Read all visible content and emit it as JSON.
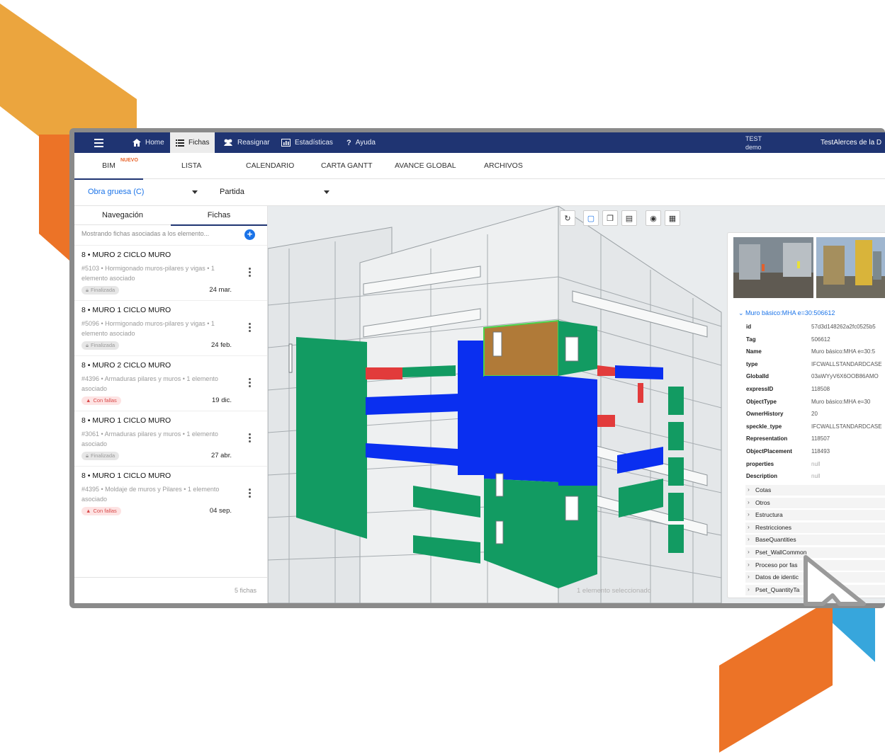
{
  "topbar": {
    "home": "Home",
    "fichas": "Fichas",
    "reasignar": "Reasignar",
    "estadisticas": "Estadísticas",
    "ayuda": "Ayuda",
    "user_line1": "TEST",
    "user_line2": "demo",
    "organization": "TestAlerces de la D"
  },
  "tabs": {
    "bim": "BIM",
    "bim_badge": "NUEVO",
    "lista": "LISTA",
    "calendario": "CALENDARIO",
    "gantt": "CARTA GANTT",
    "avance": "AVANCE GLOBAL",
    "archivos": "ARCHIVOS"
  },
  "filters": {
    "obra": "Obra gruesa (C)",
    "partida": "Partida"
  },
  "panel": {
    "tab_nav": "Navegación",
    "tab_fichas": "Fichas",
    "info": "Mostrando fichas asociadas a los elemento...",
    "count": "5 fichas",
    "cards": [
      {
        "title": "8 • MURO 2 CICLO MURO",
        "desc": "#5103 • Hormigonado muros-pilares y vigas • 1 elemento asociado",
        "status": "Finalizada",
        "date": "24 mar."
      },
      {
        "title": "8 • MURO 1 CICLO MURO",
        "desc": "#5096 • Hormigonado muros-pilares y vigas • 1 elemento asociado",
        "status": "Finalizada",
        "date": "24 feb."
      },
      {
        "title": "8 • MURO 2 CICLO MURO",
        "desc": "#4396 • Armaduras pilares y muros • 1 elemento asociado",
        "status": "Con fallas",
        "date": "19 dic."
      },
      {
        "title": "8 • MURO 1 CICLO MURO",
        "desc": "#3061 • Armaduras pilares y muros • 1 elemento asociado",
        "status": "Finalizada",
        "date": "27 abr."
      },
      {
        "title": "8 • MURO 1 CICLO MURO",
        "desc": "#4395 • Moldaje de muros y Pilares • 1 elemento asociado",
        "status": "Con fallas",
        "date": "04 sep."
      }
    ]
  },
  "viewer": {
    "status": "1 elemento seleccionado",
    "colors": {
      "green": "#129b62",
      "blue": "#0a2ff0",
      "red": "#e23b3b",
      "brown": "#b07a38",
      "base": "#e6e9ea"
    }
  },
  "props": {
    "title": "Muro básico:MHA e=30:506612",
    "rows": [
      {
        "k": "id",
        "v": "57d3d148262a2fc0525b5"
      },
      {
        "k": "Tag",
        "v": "506612"
      },
      {
        "k": "Name",
        "v": "Muro básico:MHA e=30:5"
      },
      {
        "k": "type",
        "v": "IFCWALLSTANDARDCASE"
      },
      {
        "k": "GlobalId",
        "v": "03aWYyV6X6OOB86AMO"
      },
      {
        "k": "expressID",
        "v": "118508"
      },
      {
        "k": "ObjectType",
        "v": "Muro básico:MHA e=30"
      },
      {
        "k": "OwnerHistory",
        "v": "20"
      },
      {
        "k": "speckle_type",
        "v": "IFCWALLSTANDARDCASE"
      },
      {
        "k": "Representation",
        "v": "118507"
      },
      {
        "k": "ObjectPlacement",
        "v": "118493"
      },
      {
        "k": "properties",
        "v": "null"
      },
      {
        "k": "Description",
        "v": "null"
      }
    ],
    "groups": [
      "Cotas",
      "Otros",
      "Estructura",
      "Restricciones",
      "BaseQuantities",
      "Pset_WallCommon",
      "Proceso por fas",
      "Datos de identic",
      "Pset_QuantityTa"
    ]
  },
  "brand_colors": {
    "navy": "#1f3472",
    "orange": "#ec7327",
    "yellow": "#eba53e",
    "blue": "#37a6dc"
  }
}
